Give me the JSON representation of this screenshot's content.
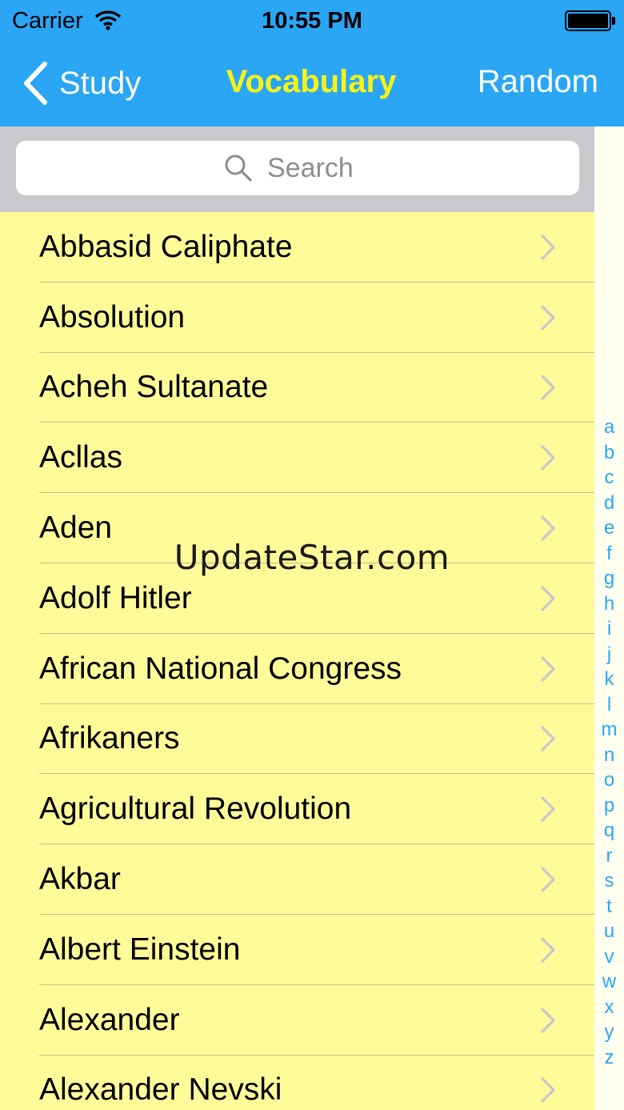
{
  "status_bar": {
    "carrier": "Carrier",
    "time": "10:55 PM",
    "icons": [
      "wifi-icon",
      "battery-icon"
    ]
  },
  "nav": {
    "back_label": "Study",
    "title": "Vocabulary",
    "right_label": "Random",
    "colors": {
      "bar": "#2aa6f5",
      "title": "#f6f31a",
      "text": "#ffffff"
    }
  },
  "search": {
    "placeholder": "Search",
    "icon": "search-icon"
  },
  "list": {
    "background": "#fffb99",
    "items": [
      "Abbasid Caliphate",
      "Absolution",
      "Acheh Sultanate",
      "Acllas",
      "Aden",
      "Adolf Hitler",
      "African National Congress",
      "Afrikaners",
      "Agricultural Revolution",
      "Akbar",
      "Albert Einstein",
      "Alexander",
      "Alexander Nevski"
    ],
    "accessory_icon": "chevron-right-icon"
  },
  "index": {
    "letters": [
      "a",
      "b",
      "c",
      "d",
      "e",
      "f",
      "g",
      "h",
      "i",
      "j",
      "k",
      "l",
      "m",
      "n",
      "o",
      "p",
      "q",
      "r",
      "s",
      "t",
      "u",
      "v",
      "w",
      "x",
      "y",
      "z"
    ],
    "color": "#2aa6f5"
  },
  "watermark": "UpdateStar.com"
}
